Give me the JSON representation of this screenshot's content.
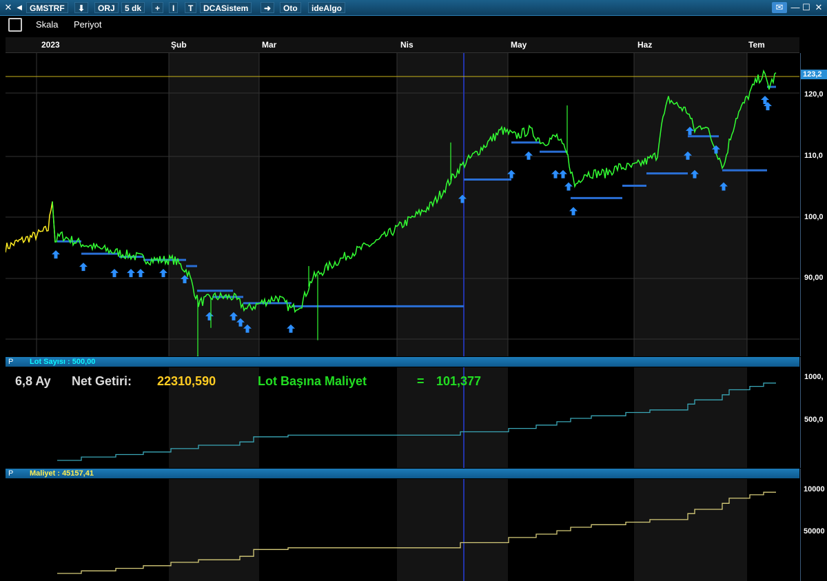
{
  "titlebar": {
    "symbol": "GMSTRF",
    "mode": "ORJ",
    "period": "5 dk",
    "plus": "+",
    "bar": "I",
    "t": "T",
    "system": "DCASistem",
    "arrow": "➜",
    "oto": "Oto",
    "algo": "ideAlgo"
  },
  "toolbar": {
    "scale_label": "Skala",
    "period_label": "Periyot"
  },
  "months": [
    "2023",
    "Şub",
    "Mar",
    "Nis",
    "May",
    "Haz",
    "Tem"
  ],
  "price_scale": {
    "last": "123,2",
    "ticks": [
      "120,0",
      "110,0",
      "100,0",
      "90,00"
    ]
  },
  "lot_panel": {
    "p": "P",
    "label": "Lot Sayısı :  500,00",
    "ticks": [
      "1000,",
      "500,0"
    ]
  },
  "cost_panel": {
    "p": "P",
    "label": "Maliyet :  45157,41",
    "ticks": [
      "10000",
      "50000"
    ]
  },
  "summary": {
    "duration": "6,8 Ay",
    "net_label": "Net Getiri:",
    "net_value": "22310,590",
    "cost_label": "Lot Başına Maliyet",
    "eq": "=",
    "cost_value": "101,377"
  },
  "colors": {
    "price_line": "#33ff33",
    "early_price": "#ffee22",
    "buy_arrow": "#2d8fff",
    "avg_line": "#2a6fd6",
    "lot_line": "#3aa7b7",
    "cost_line": "#d6cc7a",
    "last_price_line": "#c9b31a"
  },
  "chart_data": {
    "type": "line",
    "x": [
      "2023",
      "Şub",
      "Mar",
      "Nis",
      "May",
      "Haz",
      "Tem"
    ],
    "series": [
      {
        "values": [
          96.0,
          91.0,
          86.0,
          105.0,
          110.0,
          107.0,
          122.0
        ]
      }
    ],
    "ylim": [
      80,
      125
    ],
    "last_value": 123.2,
    "buy_signals_count": 40
  }
}
